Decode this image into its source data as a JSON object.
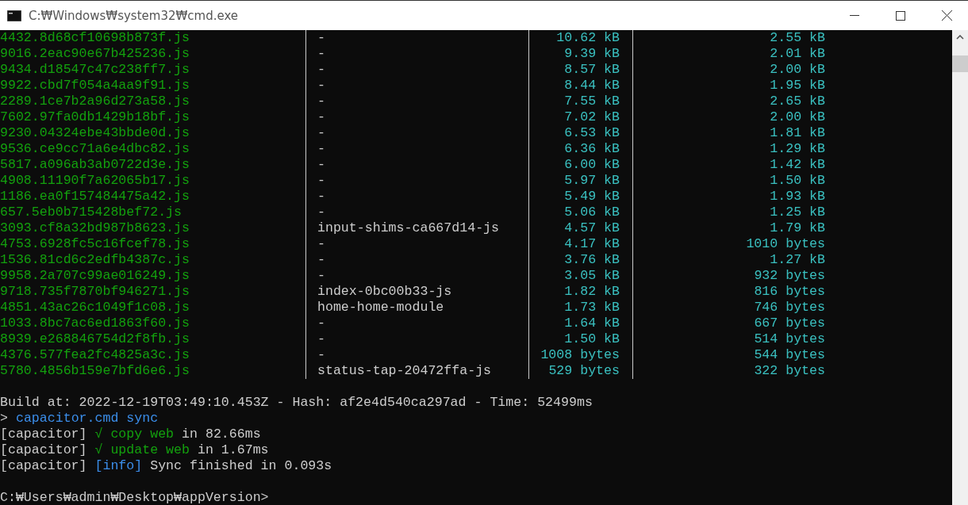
{
  "window": {
    "title": "C:₩Windows₩system32₩cmd.exe"
  },
  "table": {
    "rows": [
      {
        "file": "4432.8d68cf10698b873f.js",
        "chunk": "-",
        "raw_size": "10.62 kB",
        "transfer_size": "2.55 kB"
      },
      {
        "file": "9016.2eac90e67b425236.js",
        "chunk": "-",
        "raw_size": "9.39 kB",
        "transfer_size": "2.01 kB"
      },
      {
        "file": "9434.d18547c47c238ff7.js",
        "chunk": "-",
        "raw_size": "8.57 kB",
        "transfer_size": "2.00 kB"
      },
      {
        "file": "9922.cbd7f054a4aa9f91.js",
        "chunk": "-",
        "raw_size": "8.44 kB",
        "transfer_size": "1.95 kB"
      },
      {
        "file": "2289.1ce7b2a96d273a58.js",
        "chunk": "-",
        "raw_size": "7.55 kB",
        "transfer_size": "2.65 kB"
      },
      {
        "file": "7602.97fa0db1429b18bf.js",
        "chunk": "-",
        "raw_size": "7.02 kB",
        "transfer_size": "2.00 kB"
      },
      {
        "file": "9230.04324ebe43bbde0d.js",
        "chunk": "-",
        "raw_size": "6.53 kB",
        "transfer_size": "1.81 kB"
      },
      {
        "file": "9536.ce9cc71a6e4dbc82.js",
        "chunk": "-",
        "raw_size": "6.36 kB",
        "transfer_size": "1.29 kB"
      },
      {
        "file": "5817.a096ab3ab0722d3e.js",
        "chunk": "-",
        "raw_size": "6.00 kB",
        "transfer_size": "1.42 kB"
      },
      {
        "file": "4908.11190f7a62065b17.js",
        "chunk": "-",
        "raw_size": "5.97 kB",
        "transfer_size": "1.50 kB"
      },
      {
        "file": "1186.ea0f157484475a42.js",
        "chunk": "-",
        "raw_size": "5.49 kB",
        "transfer_size": "1.93 kB"
      },
      {
        "file": "657.5eb0b715428bef72.js",
        "chunk": "-",
        "raw_size": "5.06 kB",
        "transfer_size": "1.25 kB"
      },
      {
        "file": "3093.cf8a32bd987b8623.js",
        "chunk": "input-shims-ca667d14-js",
        "raw_size": "4.57 kB",
        "transfer_size": "1.79 kB"
      },
      {
        "file": "4753.6928fc5c16fcef78.js",
        "chunk": "-",
        "raw_size": "4.17 kB",
        "transfer_size": "1010 bytes"
      },
      {
        "file": "1536.81cd6c2edfb4387c.js",
        "chunk": "-",
        "raw_size": "3.76 kB",
        "transfer_size": "1.27 kB"
      },
      {
        "file": "9958.2a707c99ae016249.js",
        "chunk": "-",
        "raw_size": "3.05 kB",
        "transfer_size": "932 bytes"
      },
      {
        "file": "9718.735f7870bf946271.js",
        "chunk": "index-0bc00b33-js",
        "raw_size": "1.82 kB",
        "transfer_size": "816 bytes"
      },
      {
        "file": "4851.43ac26c1049f1c08.js",
        "chunk": "home-home-module",
        "raw_size": "1.73 kB",
        "transfer_size": "746 bytes"
      },
      {
        "file": "1033.8bc7ac6ed1863f60.js",
        "chunk": "-",
        "raw_size": "1.64 kB",
        "transfer_size": "667 bytes"
      },
      {
        "file": "8939.e268846754d2f8fb.js",
        "chunk": "-",
        "raw_size": "1.50 kB",
        "transfer_size": "514 bytes"
      },
      {
        "file": "4376.577fea2fc4825a3c.js",
        "chunk": "-",
        "raw_size": "1008 bytes",
        "transfer_size": "544 bytes"
      },
      {
        "file": "5780.4856b159e7bfd6e6.js",
        "chunk": "status-tap-20472ffa-js",
        "raw_size": "529 bytes",
        "transfer_size": "322 bytes"
      }
    ]
  },
  "log": [
    {
      "kind": "blank"
    },
    {
      "kind": "text",
      "segments": [
        {
          "kind": "plain",
          "text": "Build at: 2022-12-19T03:49:10.453Z - Hash: af2e4d540ca297ad - Time: 52499ms"
        }
      ]
    },
    {
      "kind": "text",
      "segments": [
        {
          "kind": "plain",
          "text": "> "
        },
        {
          "kind": "command",
          "text": "capacitor.cmd sync"
        }
      ]
    },
    {
      "kind": "text",
      "segments": [
        {
          "kind": "plain",
          "text": "[capacitor] "
        },
        {
          "kind": "success",
          "text": "√ copy web"
        },
        {
          "kind": "plain",
          "text": " in 82.66ms"
        }
      ]
    },
    {
      "kind": "text",
      "segments": [
        {
          "kind": "plain",
          "text": "[capacitor] "
        },
        {
          "kind": "success",
          "text": "√ update web"
        },
        {
          "kind": "plain",
          "text": " in 1.67ms"
        }
      ]
    },
    {
      "kind": "text",
      "segments": [
        {
          "kind": "plain",
          "text": "[capacitor] "
        },
        {
          "kind": "info",
          "text": "[info]"
        },
        {
          "kind": "plain",
          "text": " Sync finished in 0.093s"
        }
      ]
    },
    {
      "kind": "blank"
    },
    {
      "kind": "text",
      "segments": [
        {
          "kind": "plain",
          "text": "C:₩Users₩admin₩Desktop₩appVersion>"
        }
      ]
    }
  ]
}
